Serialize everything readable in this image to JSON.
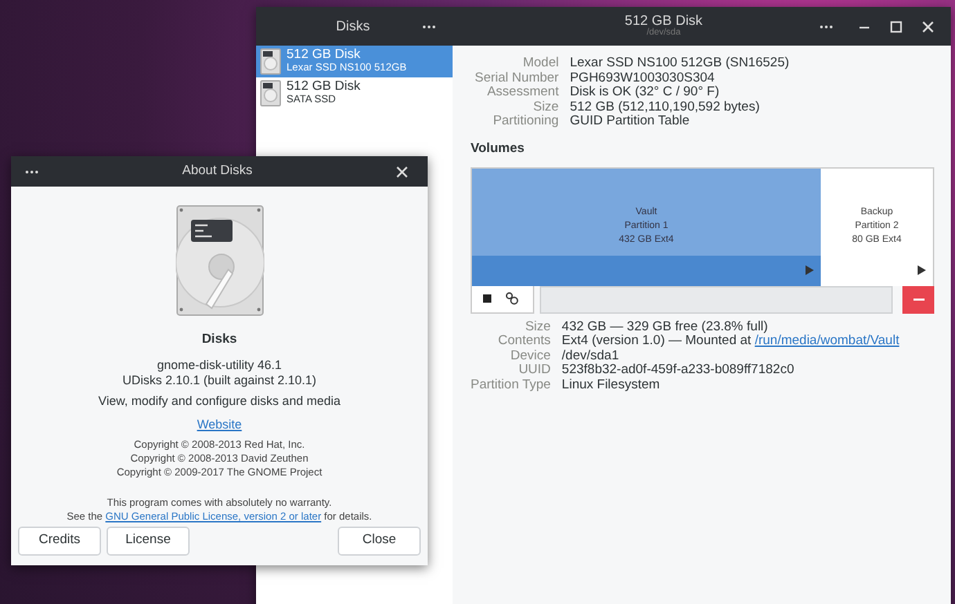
{
  "main_window": {
    "sidebar_title": "Disks",
    "title": "512 GB Disk",
    "subtitle": "/dev/sda",
    "disks": [
      {
        "name": "512 GB Disk",
        "description": "Lexar SSD NS100 512GB",
        "selected": true
      },
      {
        "name": "512 GB Disk",
        "description": "SATA SSD",
        "selected": false
      }
    ],
    "details": [
      {
        "label": "Model",
        "value": "Lexar SSD NS100 512GB (SN16525)"
      },
      {
        "label": "Serial Number",
        "value": "PGH693W1003030S304"
      },
      {
        "label": "Assessment",
        "value": "Disk is OK (32° C / 90° F)"
      },
      {
        "label": "Size",
        "value": "512 GB (512,110,190,592 bytes)"
      },
      {
        "label": "Partitioning",
        "value": "GUID Partition Table"
      }
    ],
    "volumes_heading": "Volumes",
    "partitions": [
      {
        "name": "Vault",
        "number": "Partition 1",
        "size": "432 GB Ext4",
        "selected": true
      },
      {
        "name": "Backup",
        "number": "Partition 2",
        "size": "80 GB Ext4",
        "selected": false
      }
    ],
    "partition_details": [
      {
        "label": "Size",
        "value": "432 GB — 329 GB free (23.8% full)"
      },
      {
        "label": "Contents",
        "value": "Ext4 (version 1.0) — Mounted at ",
        "link": "/run/media/wombat/Vault"
      },
      {
        "label": "Device",
        "value": "/dev/sda1"
      },
      {
        "label": "UUID",
        "value": "523f8b32-ad0f-459f-a233-b089ff7182c0"
      },
      {
        "label": "Partition Type",
        "value": "Linux Filesystem"
      }
    ]
  },
  "about_dialog": {
    "title": "About Disks",
    "app_name": "Disks",
    "version": "gnome-disk-utility 46.1",
    "udisks": "UDisks 2.10.1 (built against 2.10.1)",
    "description": "View, modify and configure disks and media",
    "website": "Website",
    "copyrights": [
      "Copyright © 2008-2013 Red Hat, Inc.",
      "Copyright © 2008-2013 David Zeuthen",
      "Copyright © 2009-2017 The GNOME Project"
    ],
    "warranty": "This program comes with absolutely no warranty.",
    "license_prefix": "See the ",
    "license_link": "GNU General Public License, version 2 or later",
    "license_suffix": " for details.",
    "buttons": [
      "Credits",
      "License",
      "Close"
    ]
  }
}
